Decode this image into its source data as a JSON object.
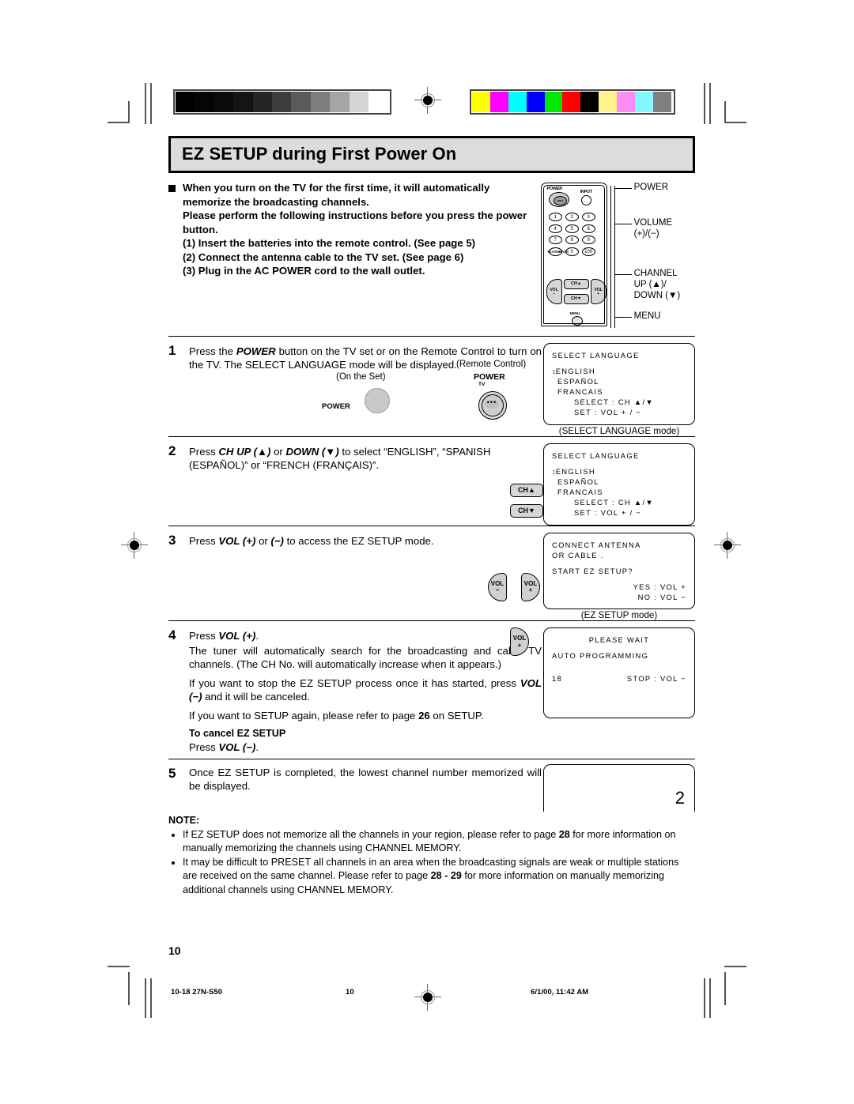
{
  "document": {
    "title": "EZ SETUP during First Power On",
    "page_number": "10",
    "footer": {
      "file_id": "10-18 27N-S50",
      "page": "10",
      "timestamp": "6/1/00, 11:42 AM"
    }
  },
  "calibration": {
    "gray_bar": [
      "#000000",
      "#050505",
      "#0b0b0b",
      "#141414",
      "#242424",
      "#3c3c3c",
      "#5a5a5a",
      "#7d7d7d",
      "#a5a5a5",
      "#d4d4d4",
      "#ffffff"
    ],
    "color_bar": [
      "#ffff00",
      "#ff00ff",
      "#00ffff",
      "#0000ff",
      "#00e800",
      "#ff0000",
      "#000000",
      "#fff389",
      "#ff8cf5",
      "#84f6ff",
      "#808080"
    ]
  },
  "intro": {
    "line1": "When you turn on the TV for the first time, it will automatically memorize the broadcasting channels.",
    "line2": "Please perform the following instructions before you press the power button.",
    "sub_items": [
      "(1) Insert the batteries into the remote control. (See page 5)",
      "(2) Connect the antenna cable to the TV set.  (See page 6)",
      "(3) Plug in the AC POWER cord to the wall outlet."
    ]
  },
  "remote_diagram": {
    "power_label": "POWER",
    "power_button_text": "ooo",
    "input_label": "INPUT",
    "keys": [
      "1",
      "2",
      "3",
      "4",
      "5",
      "6",
      "7",
      "8",
      "9",
      "0",
      "100"
    ],
    "flashback_label": "FLASHBACK",
    "vol_minus": "VOL\n−",
    "vol_plus": "VOL\n+",
    "ch_up": "CH▲",
    "ch_down": "CH▼",
    "menu_label": "MENU",
    "callouts": {
      "power": "POWER",
      "volume": "VOLUME\n(+)/(−)",
      "channel": "CHANNEL\nUP (▲)/\nDOWN (▼)",
      "menu": "MENU"
    }
  },
  "steps": [
    {
      "num": "1",
      "text": "Press the POWER button on the TV set or on the Remote Control to turn on the TV. The SELECT LANGUAGE mode will be displayed.",
      "text_pre": "Press the ",
      "text_kw": "POWER",
      "text_post": " button on the TV set or on the Remote Control to turn on the TV. The SELECT LANGUAGE mode will be displayed.",
      "illustration": {
        "on_the_set": "(On the Set)",
        "remote_control": "(Remote Control)",
        "set_power_label": "POWER",
        "remote_power_label": "POWER",
        "remote_tv_label": "TV",
        "remote_dots": "•••"
      },
      "screen": {
        "title": "SELECT  LANGUAGE",
        "options": [
          "ENGLISH",
          "ESPAÑOL",
          "FRANCAIS"
        ],
        "cursor": "↕",
        "hint_select": "SELECT : CH  ▲/▼",
        "hint_set": "SET        : VOL + / −",
        "caption": "(SELECT LANGUAGE mode)"
      }
    },
    {
      "num": "2",
      "text_pre": "Press ",
      "text_kw1": "CH UP (▲)",
      "text_mid": " or ",
      "text_kw2": "DOWN (▼)",
      "text_post": " to select “ENGLISH”, “SPANISH (ESPAÑOL)” or “FRENCH (FRANÇAIS)”.",
      "keys": [
        "CH▲",
        "CH▼"
      ],
      "screen": {
        "title": "SELECT  LANGUAGE",
        "options": [
          "ENGLISH",
          "ESPAÑOL",
          "FRANCAIS"
        ],
        "cursor": "↕",
        "hint_select": "SELECT : CH  ▲/▼",
        "hint_set": "SET        : VOL + / −",
        "caption": ""
      }
    },
    {
      "num": "3",
      "text_pre": "Press ",
      "text_kw1": "VOL (+)",
      "text_mid": " or ",
      "text_kw2": "(−)",
      "text_post": " to access the EZ SETUP mode.",
      "keys": [
        "VOL\n−",
        "VOL\n+"
      ],
      "screen": {
        "line1": "CONNECT  ANTENNA",
        "line2": " OR  CABLE .",
        "line3": "START  EZ  SETUP?",
        "line4": "YES : VOL +",
        "line5": "NO   : VOL −",
        "caption": "(EZ SETUP mode)"
      }
    },
    {
      "num": "4",
      "para1_pre": "Press ",
      "para1_kw": "VOL (+)",
      "para1_post": ".",
      "para2": "The tuner will automatically search for the broadcasting and cable TV channels. (The CH No. will automatically increase when it appears.)",
      "para3_pre": "If you want to stop the EZ SETUP process once it has started, press ",
      "para3_kw": "VOL (−)",
      "para3_post": " and it will be canceled.",
      "para4_pre": "If you want to SETUP again, please refer to page ",
      "para4_page": "26",
      "para4_post": " on SETUP.",
      "cancel_title": "To cancel EZ SETUP",
      "cancel_pre": "Press ",
      "cancel_kw": "VOL (−)",
      "cancel_post": ".",
      "key": "VOL\n+",
      "screen": {
        "line1": "PLEASE  WAIT",
        "line2": "AUTO  PROGRAMMING",
        "line3": "18",
        "line4": "STOP : VOL −"
      }
    },
    {
      "num": "5",
      "text": "Once EZ SETUP is completed, the lowest channel number memorized will be displayed.",
      "screen": {
        "channel": "2"
      }
    }
  ],
  "note": {
    "title": "NOTE:",
    "items": [
      {
        "pre": "If EZ SETUP does not memorize all the channels in your region, please refer to page ",
        "page": "28",
        "post": " for more information on manually memorizing the channels using CHANNEL MEMORY."
      },
      {
        "pre": "It may be difficult to PRESET all channels in an area when the broadcasting signals are weak or multiple stations are received on the same channel.  Please refer to page ",
        "page": "28 - 29",
        "post": " for more information on manually memorizing additional channels using CHANNEL MEMORY."
      }
    ]
  }
}
